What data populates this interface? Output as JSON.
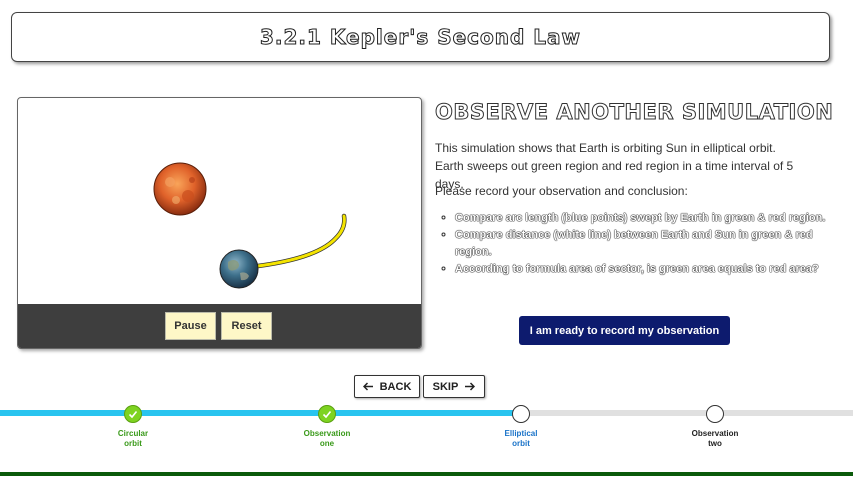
{
  "title": "3.2.1 Kepler's Second Law",
  "simulation": {
    "pause_label": "Pause",
    "reset_label": "Reset"
  },
  "content": {
    "heading": "OBSERVE ANOTHER SIMULATION",
    "description": "This simulation shows that Earth is orbiting Sun in elliptical orbit. Earth sweeps out green region and red region in a time interval of 5 days.",
    "instruction": "Please record your observation and conclusion:",
    "bullets": [
      "Compare arc length (blue points) swept by Earth in green & red region.",
      "Compare distance (white line) between Earth and Sun in green & red region.",
      "According to formula area of sector, is green area equals to red area?"
    ],
    "record_button": "I am ready to record my observation"
  },
  "navigation": {
    "back_label": "BACK",
    "skip_label": "SKIP"
  },
  "progress": {
    "steps": [
      {
        "label_line1": "Circular",
        "label_line2": "orbit",
        "status": "completed"
      },
      {
        "label_line1": "Observation",
        "label_line2": "one",
        "status": "completed"
      },
      {
        "label_line1": "Elliptical",
        "label_line2": "orbit",
        "status": "current"
      },
      {
        "label_line1": "Observation",
        "label_line2": "two",
        "status": "pending"
      }
    ]
  },
  "colors": {
    "progress_done": "#29c4ef",
    "progress_pending": "#e0e0e0",
    "step_complete": "#7ed321",
    "step_label_complete": "#3a9a1a",
    "step_label_current": "#1a73c8",
    "record_button": "#0d1b6e",
    "control_bar": "#3e3e3e",
    "control_button": "#fef7c7",
    "orbit_trail": "#f4e400"
  },
  "icons": {
    "back": "arrow-left-icon",
    "skip": "arrow-right-icon",
    "step_complete": "check-icon"
  }
}
